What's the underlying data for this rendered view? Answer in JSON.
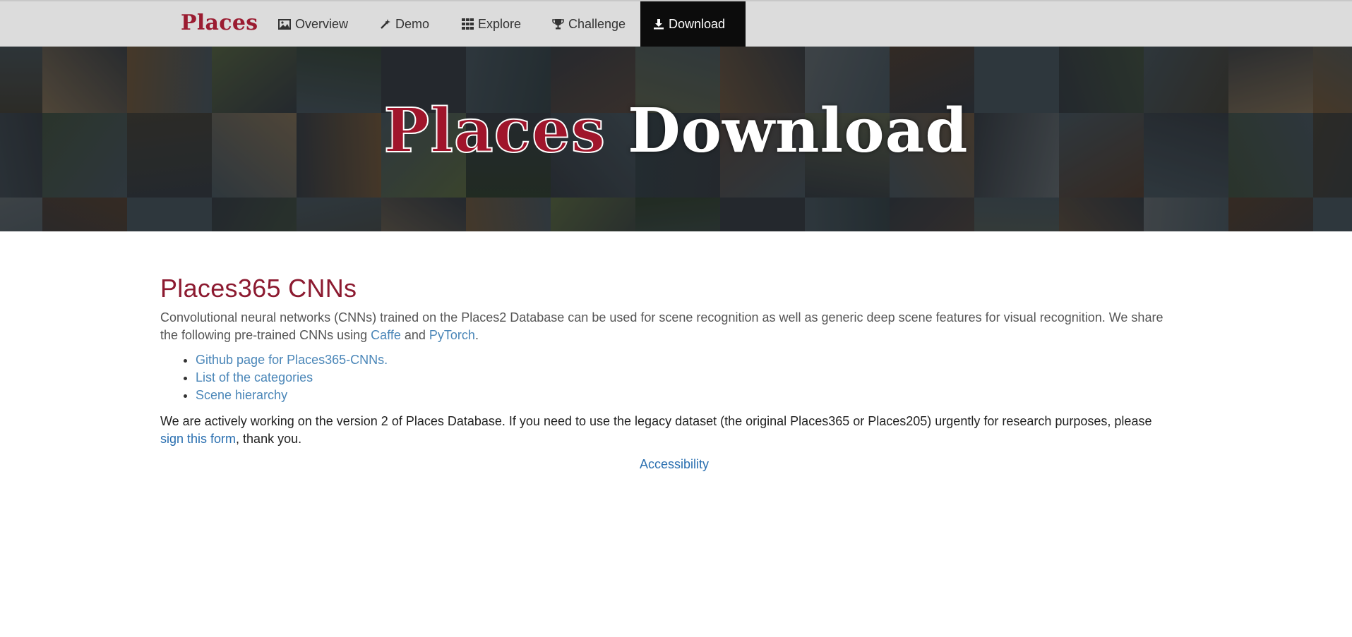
{
  "navbar": {
    "brand": "Places",
    "items": [
      {
        "label": "Overview",
        "icon": "image-icon"
      },
      {
        "label": "Demo",
        "icon": "magic-wand-icon"
      },
      {
        "label": "Explore",
        "icon": "grid-icon"
      },
      {
        "label": "Challenge",
        "icon": "trophy-icon"
      },
      {
        "label": "Download",
        "icon": "download-icon",
        "active": true
      }
    ]
  },
  "hero": {
    "title_part1": "Places",
    "title_part2": "Download"
  },
  "main": {
    "heading": "Places365 CNNs",
    "intro_text_1": "Convolutional neural networks (CNNs) trained on the Places2 Database can be used for scene recognition as well as generic deep scene features for visual recognition. We share the following pre-trained CNNs using ",
    "intro_link_caffe": "Caffe",
    "intro_and": " and ",
    "intro_link_pytorch": "PyTorch",
    "intro_end": ".",
    "links": [
      "Github page for Places365-CNNs.",
      "List of the categories",
      "Scene hierarchy"
    ],
    "notice_text": "We are actively working on the version 2 of Places Database. If you need to use the legacy dataset (the original Places365 or Places205) urgently for research purposes, please ",
    "notice_link": "sign this form",
    "notice_end": ", thank you."
  },
  "footer": {
    "accessibility": "Accessibility"
  },
  "colors": {
    "brand": "#9b1c31",
    "heading": "#8c1a30",
    "link": "#4a86b8",
    "nav_active_bg": "#0c0c0c"
  }
}
